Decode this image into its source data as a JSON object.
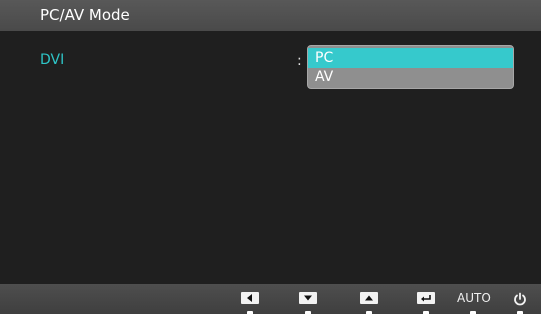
{
  "header": {
    "title": "PC/AV Mode"
  },
  "setting": {
    "label": "DVI",
    "separator": ":",
    "options": [
      {
        "label": "PC",
        "selected": true
      },
      {
        "label": "AV",
        "selected": false
      }
    ]
  },
  "footer": {
    "buttons": [
      {
        "icon": "left-arrow-icon"
      },
      {
        "icon": "down-arrow-icon"
      },
      {
        "icon": "up-arrow-icon"
      },
      {
        "icon": "enter-icon"
      }
    ],
    "auto_label": "AUTO",
    "power_icon": "power-icon"
  },
  "colors": {
    "accent": "#36c9cc",
    "label": "#2ec5c7",
    "background": "#1f1f1f"
  }
}
